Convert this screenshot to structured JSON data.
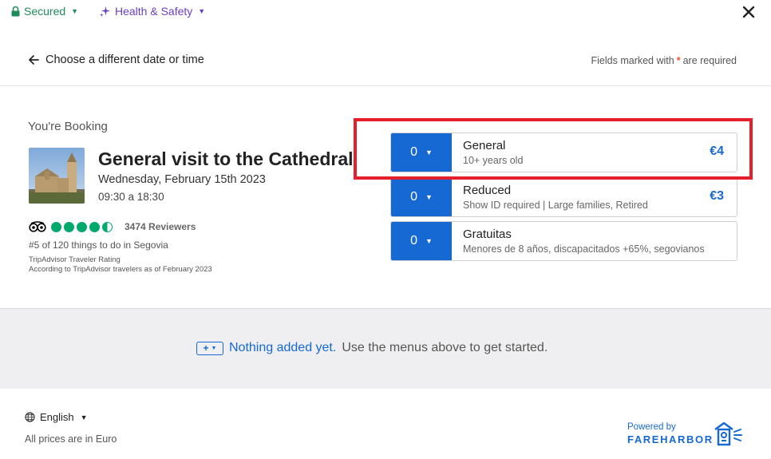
{
  "topbar": {
    "secured_label": "Secured",
    "health_label": "Health & Safety",
    "close_icon": "close-icon"
  },
  "nav": {
    "back_label": "Choose a different date or time",
    "required_prefix": "Fields marked with",
    "required_star": "*",
    "required_suffix": "are required"
  },
  "booking": {
    "label": "You're Booking",
    "title": "General visit to the Cathedral",
    "date": "Wednesday, February 15th 2023",
    "time": "09:30 a 18:30",
    "reviewers": "3474 Reviewers",
    "rating_bubbles": 4.5,
    "rank": "#5 of 120 things to do in Segovia",
    "ta_rating_note": "TripAdvisor Traveler Rating",
    "ta_source_note": "According to TripAdvisor travelers as of February 2023"
  },
  "tickets": [
    {
      "qty": "0",
      "name": "General",
      "subtitle": "10+ years old",
      "price": "€4"
    },
    {
      "qty": "0",
      "name": "Reduced",
      "subtitle": "Show ID required | Large families, Retired",
      "price": "€3"
    },
    {
      "qty": "0",
      "name": "Gratuitas",
      "subtitle": "Menores de 8 años, discapacitados +65%, segovianos",
      "price": ""
    }
  ],
  "summary": {
    "plus_label": "+",
    "nothing_label": "Nothing added yet.",
    "hint": "Use the menus above to get started."
  },
  "footer": {
    "language": "English",
    "prices_note": "All prices are in Euro",
    "powered_by": "Powered by",
    "brand": "FAREHARBOR"
  },
  "colors": {
    "accent": "#1669d3",
    "secured": "#1e8c5a",
    "health": "#6b3fc4",
    "highlight": "#e3202b",
    "rating": "#00aa6c",
    "required_star": "#f0532b"
  }
}
